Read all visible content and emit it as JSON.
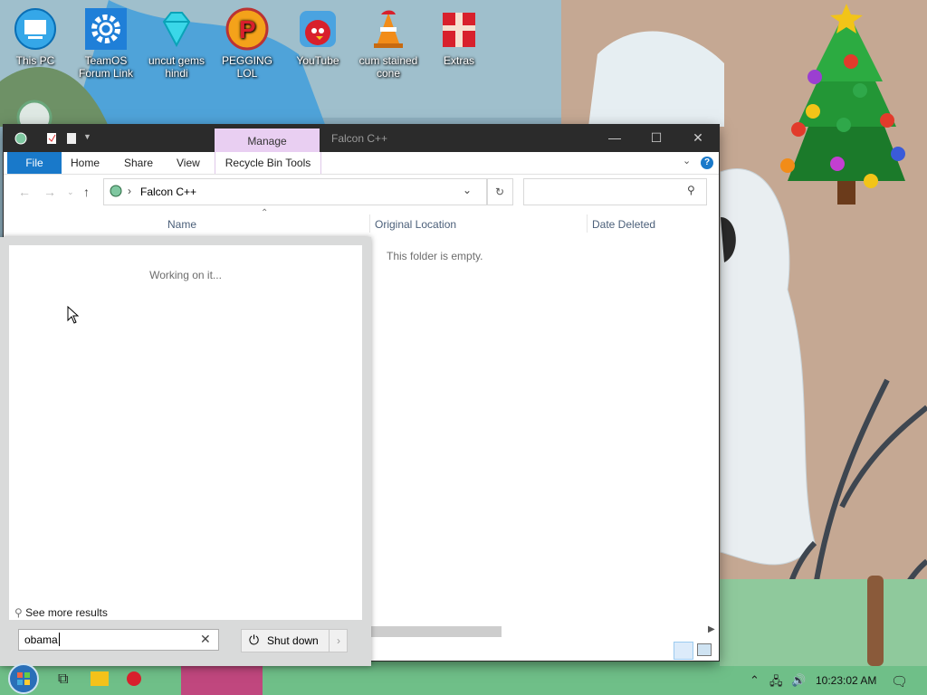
{
  "desktop": {
    "icons": [
      {
        "label": "This PC"
      },
      {
        "label": "TeamOS Forum Link"
      },
      {
        "label": "uncut gems hindi"
      },
      {
        "label": "PEGGING LOL"
      },
      {
        "label": "YouTube"
      },
      {
        "label": "cum stained cone"
      },
      {
        "label": "Extras"
      }
    ]
  },
  "explorer": {
    "title": "Falcon C++",
    "context_tab": "Manage",
    "ribbon_tabs": [
      "File",
      "Home",
      "Share",
      "View",
      "Recycle Bin Tools"
    ],
    "address": "Falcon C++",
    "columns": [
      "Name",
      "Original Location",
      "Date Deleted"
    ],
    "empty_message": "This folder is empty.",
    "help_label": "?"
  },
  "start_menu": {
    "status": "Working on it...",
    "see_more": "See more results",
    "search_value": "obama",
    "shutdown_label": "Shut down"
  },
  "taskbar": {
    "clock": "10:23:02 AM"
  },
  "colors": {
    "file_tab": "#1979ca",
    "manage_tab": "#e9cff2",
    "titlebar": "#2b2b2b"
  }
}
